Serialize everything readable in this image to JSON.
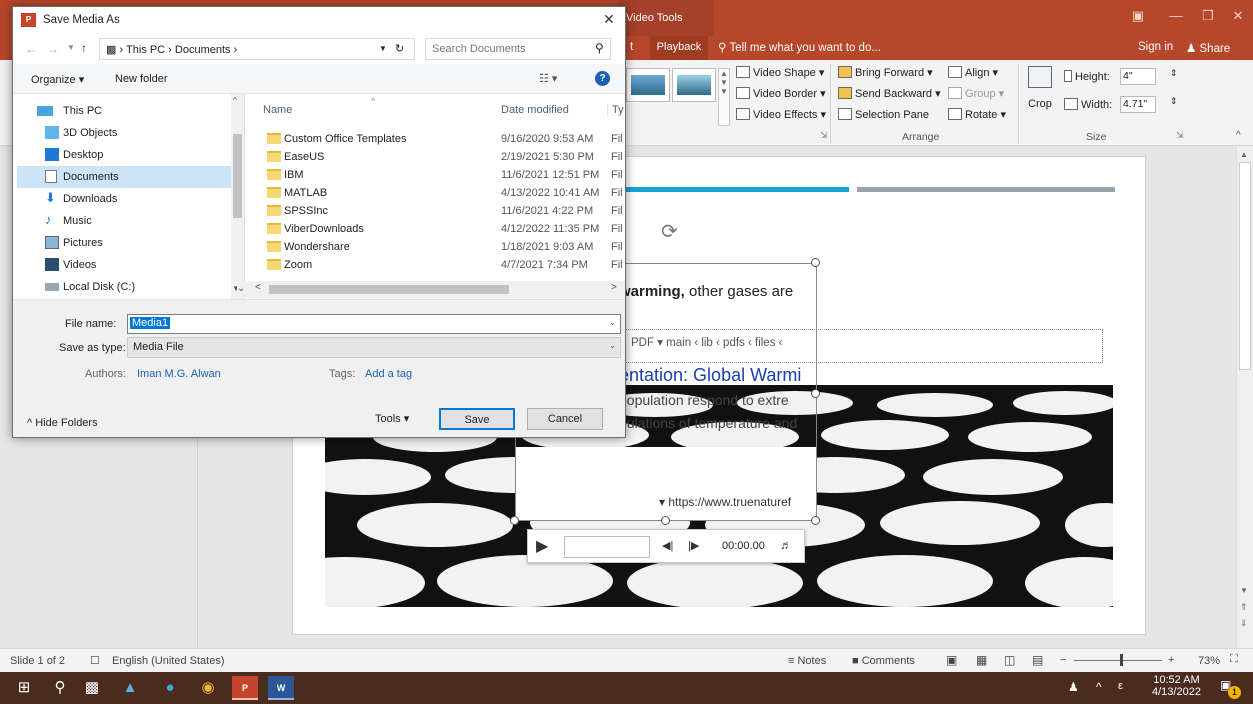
{
  "app": {
    "context_tab": "Video Tools",
    "tabs": {
      "playback": "Playback",
      "partial": "t"
    },
    "tell_me": "Tell me what you want to do...",
    "sign_in": "Sign in",
    "share": "Share"
  },
  "ribbon": {
    "video_shape": "Video Shape",
    "video_border": "Video Border",
    "video_effects": "Video Effects",
    "bring_forward": "Bring Forward",
    "send_backward": "Send Backward",
    "selection_pane": "Selection Pane",
    "align": "Align",
    "group": "Group",
    "rotate": "Rotate",
    "arrange_label": "Arrange",
    "crop": "Crop",
    "height_label": "Height:",
    "height_value": "4\"",
    "width_label": "Width:",
    "width_value": "4.71\"",
    "size_label": "Size"
  },
  "slide": {
    "text_warming_bold": "warming,",
    "text_warming_rest": " other gases are",
    "breadcrumb_pdf": "PDF",
    "breadcrumb_path": "main ‹ lib ‹ pdfs ‹ files ‹",
    "heading": "entation: Global Warmi",
    "line1": "population respond to extre",
    "line2": "pulations of temperature and",
    "url": "https://www.truenaturef",
    "video_time": "00:00.00"
  },
  "statusbar": {
    "slide_info": "Slide 1 of 2",
    "language": "English (United States)",
    "notes": "Notes",
    "comments": "Comments",
    "zoom": "73%"
  },
  "taskbar": {
    "time": "10:52 AM",
    "date": "4/13/2022",
    "notification_count": "1"
  },
  "dialog": {
    "title": "Save Media As",
    "address": [
      "This PC",
      "Documents"
    ],
    "search_placeholder": "Search Documents",
    "organize": "Organize",
    "new_folder": "New folder",
    "nav": [
      "This PC",
      "3D Objects",
      "Desktop",
      "Documents",
      "Downloads",
      "Music",
      "Pictures",
      "Videos",
      "Local Disk (C:)"
    ],
    "columns": {
      "name": "Name",
      "date": "Date modified",
      "type": "Ty"
    },
    "files": [
      {
        "name": "Custom Office Templates",
        "date": "9/16/2020 9:53 AM",
        "type": "Fil"
      },
      {
        "name": "EaseUS",
        "date": "2/19/2021 5:30 PM",
        "type": "Fil"
      },
      {
        "name": "IBM",
        "date": "11/6/2021 12:51 PM",
        "type": "Fil"
      },
      {
        "name": "MATLAB",
        "date": "4/13/2022 10:41 AM",
        "type": "Fil"
      },
      {
        "name": "SPSSInc",
        "date": "11/6/2021 4:22 PM",
        "type": "Fil"
      },
      {
        "name": "ViberDownloads",
        "date": "4/12/2022 11:35 PM",
        "type": "Fil"
      },
      {
        "name": "Wondershare",
        "date": "1/18/2021 9:03 AM",
        "type": "Fil"
      },
      {
        "name": "Zoom",
        "date": "4/7/2021 7:34 PM",
        "type": "Fil"
      }
    ],
    "file_name_label": "File name:",
    "file_name_value": "Media1",
    "save_as_type_label": "Save as type:",
    "save_as_type_value": "Media File",
    "authors_label": "Authors:",
    "authors_value": "Iman M.G. Alwan",
    "tags_label": "Tags:",
    "tags_value": "Add a tag",
    "hide_folders": "Hide Folders",
    "tools": "Tools",
    "save": "Save",
    "cancel": "Cancel"
  },
  "colors": {
    "ppt_accent": "#b7472a",
    "selection": "#cce4f7",
    "link": "#1a5fb4",
    "slide_line_blue": "#1aa2d8",
    "slide_line_gray": "#9aa3ab"
  }
}
